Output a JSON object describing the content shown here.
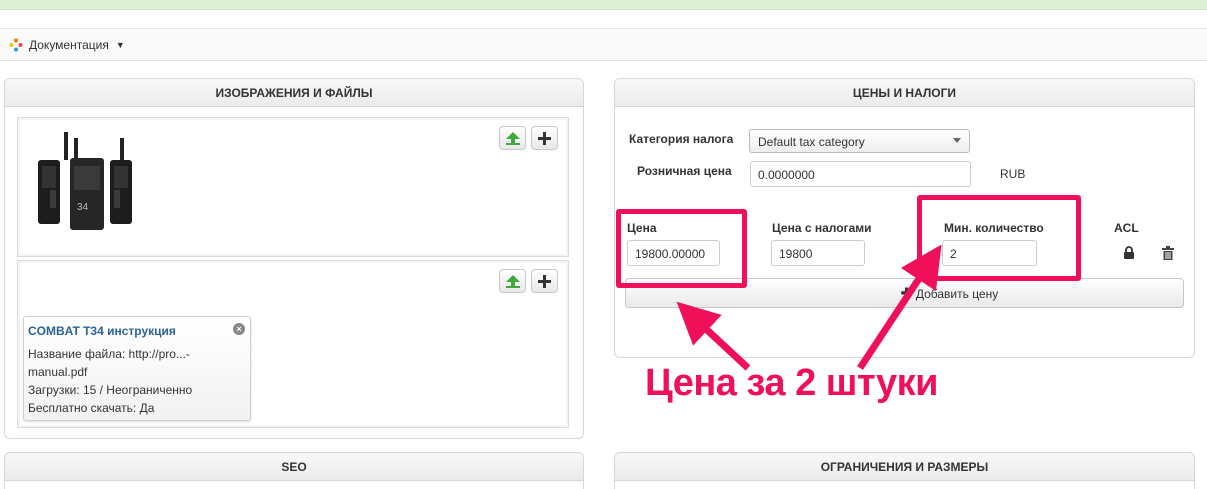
{
  "toolbar": {
    "doc_menu_label": "Документация",
    "doc_icon": "doc-cog-icon"
  },
  "left_panel": {
    "title": "ИЗОБРАЖЕНИЯ И ФАЙЛЫ",
    "image_alt": "radios-image",
    "file": {
      "title": "COMBAT T34 инструкция",
      "filename_line1": "Название файла: http://pro...-",
      "filename_line2": "manual.pdf",
      "downloads": "Загрузки: 15 / Неограниченно",
      "free": "Бесплатно скачать: Да"
    }
  },
  "right_panel": {
    "title": "ЦЕНЫ И НАЛОГИ",
    "tax_category_label": "Категория налога",
    "tax_category_value": "Default tax category",
    "retail_price_label": "Розничная цена",
    "retail_price_value": "0.0000000",
    "currency": "RUB",
    "price_label": "Цена",
    "price_value": "19800.00000",
    "price_tax_label": "Цена с налогами",
    "price_tax_value": "19800",
    "min_qty_label": "Мин. количество",
    "min_qty_value": "2",
    "acl_label": "ACL",
    "add_price_label": "Добавить цену"
  },
  "bottom": {
    "seo_title": "SEO",
    "limits_title": "ОГРАНИЧЕНИЯ И РАЗМЕРЫ"
  },
  "annotation": {
    "text": "Цена за 2 штуки",
    "color": "#f0105a"
  },
  "colors": {
    "upload_green": "#3fa93f",
    "link_blue": "#2a6496",
    "highlight": "#f0105a"
  }
}
